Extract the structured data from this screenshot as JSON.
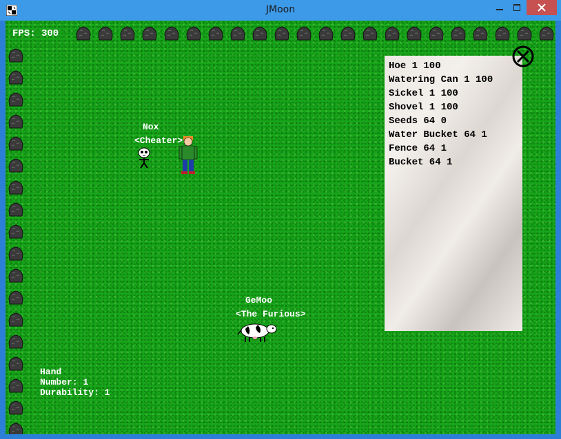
{
  "window": {
    "title": "JMoon",
    "app_icon": "jmoon-app-icon",
    "controls": [
      "minimize-icon",
      "maximize-icon",
      "close-icon"
    ]
  },
  "hud": {
    "fps_label": "FPS: 300",
    "item_name": "Hand",
    "item_number": "Number: 1",
    "item_durability": "Durability: 1"
  },
  "inventory": {
    "items": [
      "Hoe 1 100",
      "Watering Can 1 100",
      "Sickel 1 100",
      "Shovel 1 100",
      "Seeds 64 0",
      "Water Bucket 64 1",
      "Fence 64 1",
      "Bucket 64 1"
    ],
    "close_icon": "close-circle-icon"
  },
  "characters": [
    {
      "name": "Nox",
      "title": "<Cheater>"
    },
    {
      "name": "GeMoo",
      "title": "<The Furious>"
    }
  ],
  "colors": {
    "grass": "#17a51a",
    "titlebar": "#3d9ae8",
    "close_button": "#c75050",
    "text": "#ffffff"
  }
}
